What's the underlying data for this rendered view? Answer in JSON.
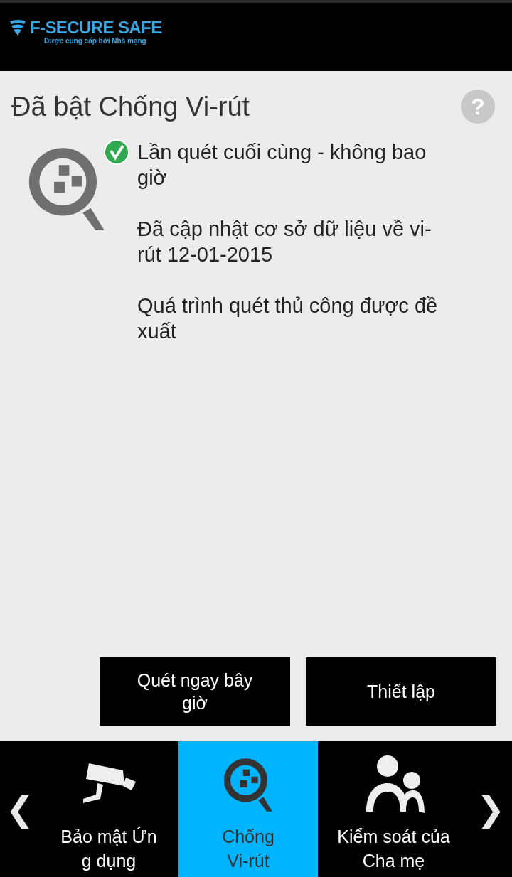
{
  "header": {
    "brand": "F-SECURE SAFE",
    "tagline": "Được cung cấp bởi Nhà mạng"
  },
  "title": "Đã bật Chống Vi-rút",
  "help": "?",
  "status": {
    "protected": true
  },
  "paragraphs": [
    [
      "Lần quét cuối cùng - không bao",
      "giờ"
    ],
    [
      "Đã cập nhật cơ sở dữ liệu về vi-",
      "rút 12-01-2015"
    ],
    [
      "Quá trình quét thủ công được đề",
      "xuất"
    ]
  ],
  "buttons": [
    [
      "Quét ngay bây",
      "giờ"
    ],
    [
      "Thiết lập"
    ]
  ],
  "nav": {
    "prev": "❮",
    "next": "❯",
    "tabs": [
      {
        "kind": "camera",
        "lines": [
          "Bảo mật Ứn",
          "g dụng"
        ],
        "selected": false
      },
      {
        "kind": "scan",
        "lines": [
          "Chống",
          "Vi-rút"
        ],
        "selected": true
      },
      {
        "kind": "family",
        "lines": [
          "Kiểm soát của",
          "Cha mẹ"
        ],
        "selected": false
      }
    ]
  }
}
